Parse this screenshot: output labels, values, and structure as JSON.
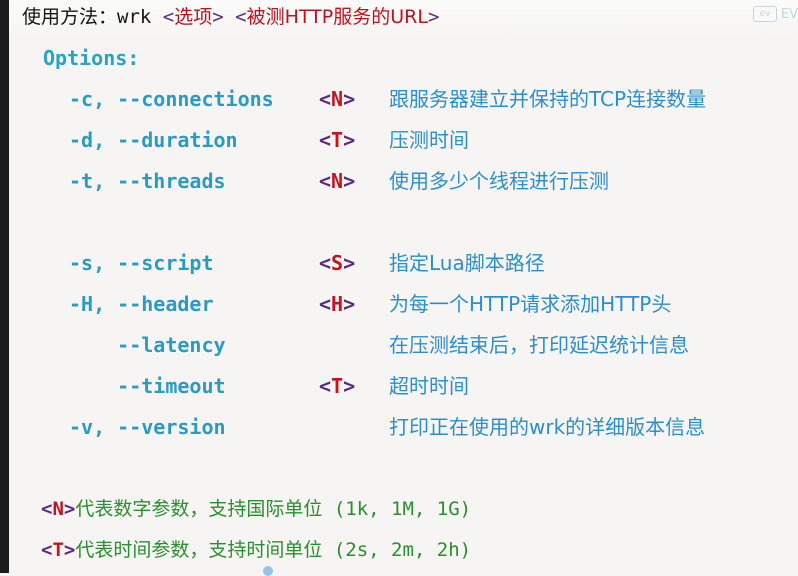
{
  "header": {
    "usage_prefix": "使用方法：",
    "command": "wrk",
    "placeholder1_open": "<",
    "placeholder1": "选项",
    "placeholder1_close": ">",
    "placeholder2_open": "<",
    "placeholder2": "被测HTTP服务的URL",
    "placeholder2_close": ">"
  },
  "watermark": {
    "logo": "ev",
    "text": "EV"
  },
  "options_heading": "Options:",
  "options": [
    {
      "flag": "-c, --connections",
      "arg": "N",
      "desc": "跟服务器建立并保持的TCP连接数量"
    },
    {
      "flag": "-d, --duration",
      "arg": "T",
      "desc": "压测时间"
    },
    {
      "flag": "-t, --threads",
      "arg": "N",
      "desc": "使用多少个线程进行压测"
    },
    {
      "flag": "-s, --script",
      "arg": "S",
      "desc": "指定Lua脚本路径"
    },
    {
      "flag": "-H, --header",
      "arg": "H",
      "desc": "为每一个HTTP请求添加HTTP头"
    },
    {
      "flag": "    --latency",
      "arg": "",
      "desc": "在压测结束后，打印延迟统计信息"
    },
    {
      "flag": "    --timeout",
      "arg": "T",
      "desc": "超时时间"
    },
    {
      "flag": "-v, --version",
      "arg": "",
      "desc": "打印正在使用的wrk的详细版本信息"
    }
  ],
  "notes": [
    {
      "arg": "N",
      "text": "代表数字参数，支持国际单位",
      "values": "(1k, 1M, 1G)"
    },
    {
      "arg": "T",
      "text": "代表时间参数，支持时间单位",
      "values": "(2s, 2m, 2h)"
    }
  ],
  "colors": {
    "flag": "#2b9bc4",
    "description": "#2b8fcf",
    "placeholder_bracket": "#5a2a82",
    "placeholder_letter": "#c4141f",
    "note_text": "#2a8f2f",
    "title_highlight": "#c1121c"
  }
}
